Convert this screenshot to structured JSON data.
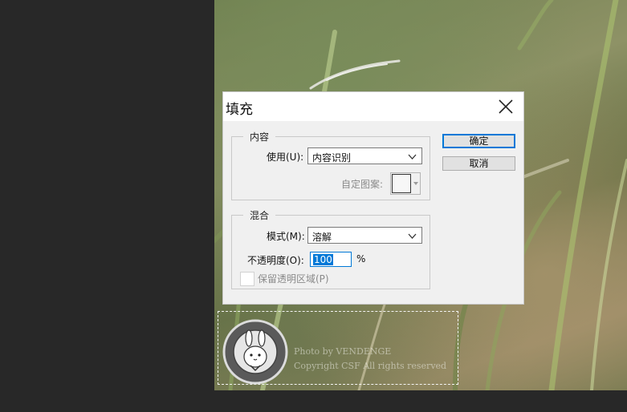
{
  "watermark": {
    "line1": "Photo by VENDENGE",
    "line2": "Copyright  CSF All rights reserved"
  },
  "dialog": {
    "title": "填充",
    "content_group": {
      "label": "内容",
      "use_label": "使用(U):",
      "use_value": "内容识别",
      "custom_pattern_label": "自定图案:"
    },
    "blend_group": {
      "label": "混合",
      "mode_label": "模式(M):",
      "mode_value": "溶解",
      "opacity_label": "不透明度(O):",
      "opacity_value": "100",
      "opacity_unit": "%",
      "preserve_label": "保留透明区域(P)",
      "preserve_checked": false
    },
    "ok_label": "确定",
    "cancel_label": "取消"
  },
  "colors": {
    "accent": "#0078d7",
    "app_background": "#282828",
    "dialog_background": "#f0f0f0"
  },
  "icons": {
    "close": "close-icon",
    "dropdown": "chevron-down-icon"
  }
}
